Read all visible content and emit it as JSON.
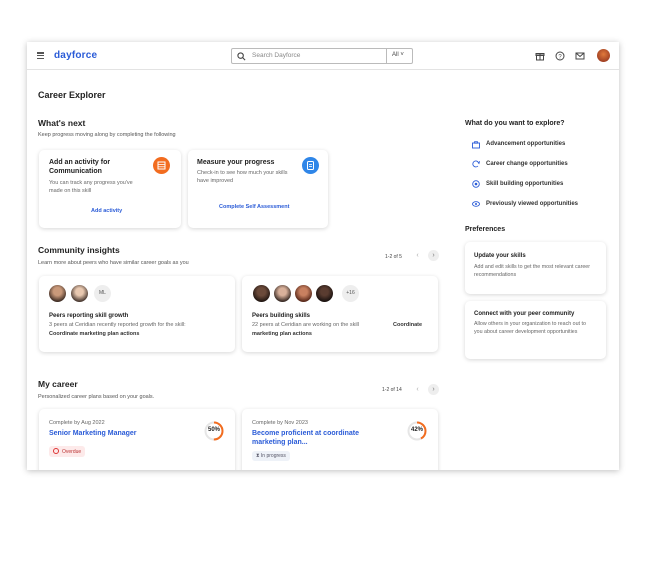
{
  "app": {
    "brand": "dayforce"
  },
  "search": {
    "placeholder": "Search Dayforce",
    "scope": "All"
  },
  "page_title": "Career Explorer",
  "whats_next": {
    "title": "What's next",
    "subtitle": "Keep progress moving along by completing the following",
    "cards": [
      {
        "title": "Add an activity for Communication",
        "desc": "You can track any progress you've made on this skill",
        "action": "Add activity",
        "color": "#f26c1f"
      },
      {
        "title": "Measure your progress",
        "desc": "Check-in to see how much your skills have improved",
        "action": "Complete Self Assessment",
        "color": "#2f86e8"
      }
    ]
  },
  "community": {
    "title": "Community insights",
    "subtitle": "Learn more about peers who have similar career goals as you",
    "pager": "1-2 of 5",
    "cards": [
      {
        "extra": "ML",
        "title": "Peers reporting skill growth",
        "desc": "3 peers at Ceridian recently reported growth for the skill:",
        "skill": "Coordinate marketing plan actions"
      },
      {
        "extra": "+16",
        "title": "Peers building skills",
        "desc": "22 peers at Ceridian are working on the skill",
        "skill_inline": "Coordinate",
        "skill": "marketing plan actions"
      }
    ]
  },
  "my_career": {
    "title": "My career",
    "subtitle": "Personalized career plans based on your goals.",
    "pager": "1-2 of 14",
    "plans": [
      {
        "complete_by": "Complete by Aug 2022",
        "title": "Senior Marketing Manager",
        "progress": 50,
        "progress_label": "50%",
        "status": "Overdue"
      },
      {
        "complete_by": "Complete by Nov 2023",
        "title_line1": "Become proficient at coordinate",
        "title_line2": "marketing plan...",
        "progress": 42,
        "progress_label": "42%",
        "status": "In progress"
      }
    ]
  },
  "explore": {
    "title": "What do you want to explore?",
    "items": [
      {
        "label": "Advancement opportunities",
        "icon": "briefcase-icon"
      },
      {
        "label": "Career change opportunities",
        "icon": "refresh-icon"
      },
      {
        "label": "Skill building opportunities",
        "icon": "target-icon"
      },
      {
        "label": "Previously viewed opportunities",
        "icon": "eye-icon"
      }
    ]
  },
  "preferences": {
    "title": "Preferences",
    "cards": [
      {
        "title": "Update your skills",
        "desc": "Add and edit skills to get the most relevant career recommendations"
      },
      {
        "title": "Connect with your peer community",
        "desc": "Allow others in your organization to reach out to you about career development opportunities"
      }
    ]
  },
  "colors": {
    "accent": "#2a5bd7",
    "orange": "#f26c1f",
    "blue": "#2f86e8",
    "overdue": "#d33"
  }
}
